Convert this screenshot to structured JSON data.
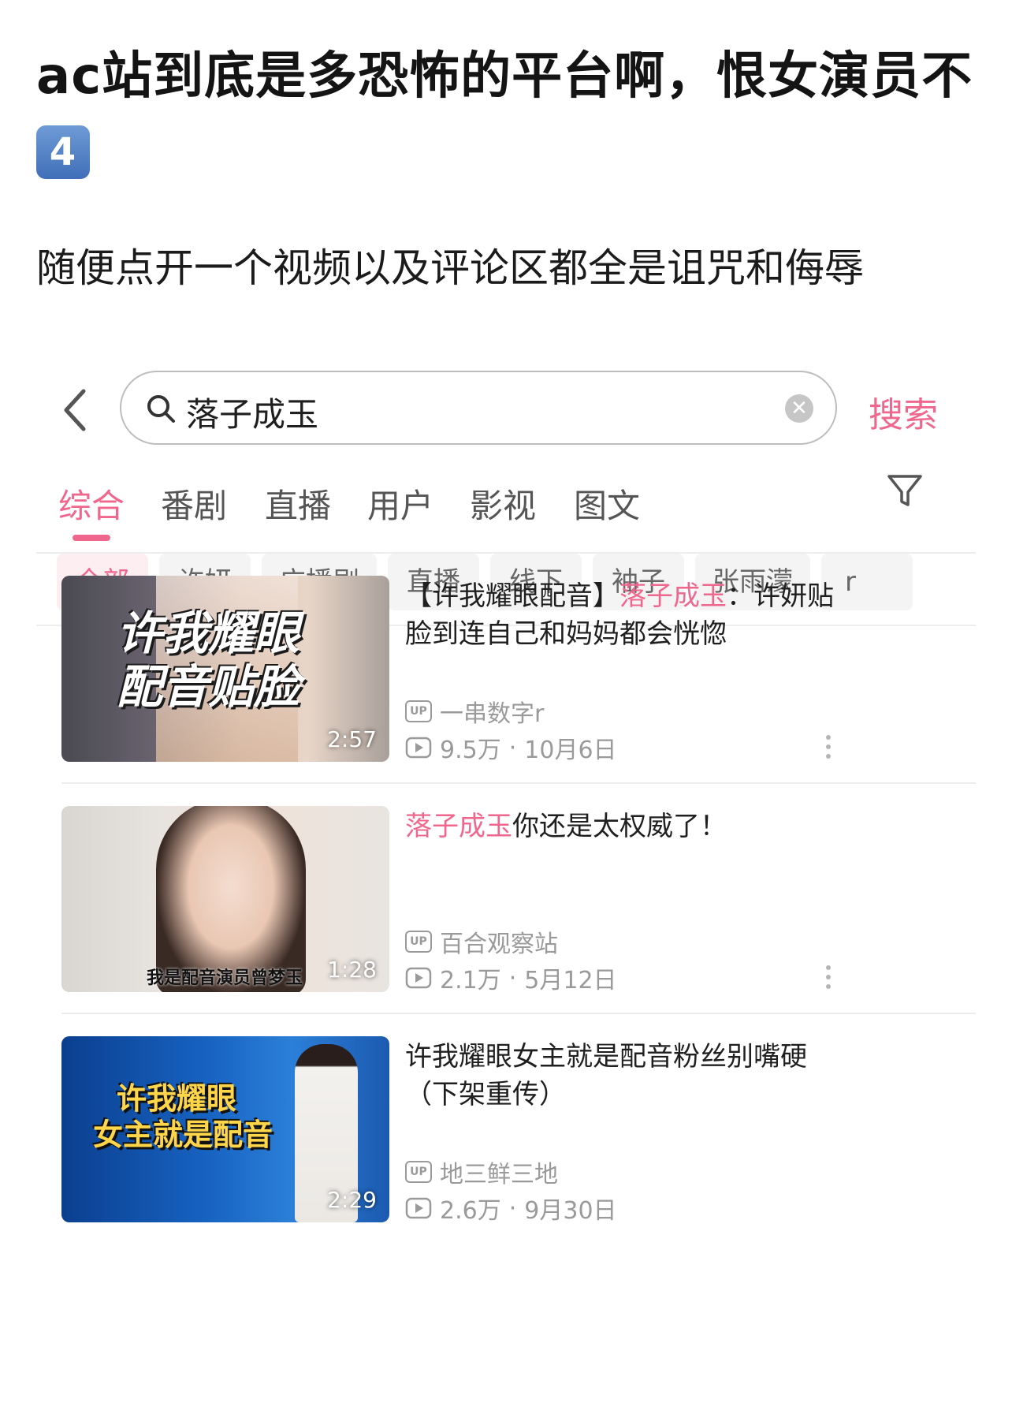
{
  "post": {
    "title": "ac站到底是多恐怖的平台啊，恨女演员不",
    "title_emoji": "4",
    "body": "随便点开一个视频以及评论区都全是诅咒和侮辱"
  },
  "search": {
    "query": "落子成玉",
    "button_label": "搜索"
  },
  "tabs": [
    "综合",
    "番剧",
    "直播",
    "用户",
    "影视",
    "图文"
  ],
  "active_tab": "综合",
  "chips": [
    "全部",
    "许妍",
    "广播剧",
    "直播",
    "线下",
    "袖子",
    "张雨濛",
    "r"
  ],
  "results": [
    {
      "title_prefix": "【许我耀眼配音】",
      "title_highlight": "落子成玉",
      "title_suffix": "：许妍贴脸到连自己和妈妈都会恍惚",
      "duration": "2:57",
      "thumb_text_line1": "许我耀眼",
      "thumb_text_line2": "配音贴脸",
      "uploader": "一串数字r",
      "views": "9.5万",
      "date": "10月6日"
    },
    {
      "title_prefix": "",
      "title_highlight": "落子成玉",
      "title_suffix": "你还是太权威了！",
      "duration": "1:28",
      "thumb_caption": "我是配音演员曾梦玉",
      "uploader": "百合观察站",
      "views": "2.1万",
      "date": "5月12日"
    },
    {
      "title_prefix": "许我耀眼女主就是配音粉丝别嘴硬（下架重传）",
      "title_highlight": "",
      "title_suffix": "",
      "duration": "2:29",
      "thumb_text_line1": "许我耀眼",
      "thumb_text_line2": "女主就是配音",
      "uploader": "地三鲜三地",
      "views": "2.6万",
      "date": "9月30日"
    }
  ],
  "up_badge": "UP",
  "meta_sep": "·",
  "colors": {
    "accent": "#f0678e",
    "muted": "#9a9a9a"
  },
  "icons": [
    "back-arrow-icon",
    "search-icon",
    "clear-icon",
    "filter-icon",
    "up-badge-icon",
    "play-count-icon",
    "more-icon"
  ]
}
